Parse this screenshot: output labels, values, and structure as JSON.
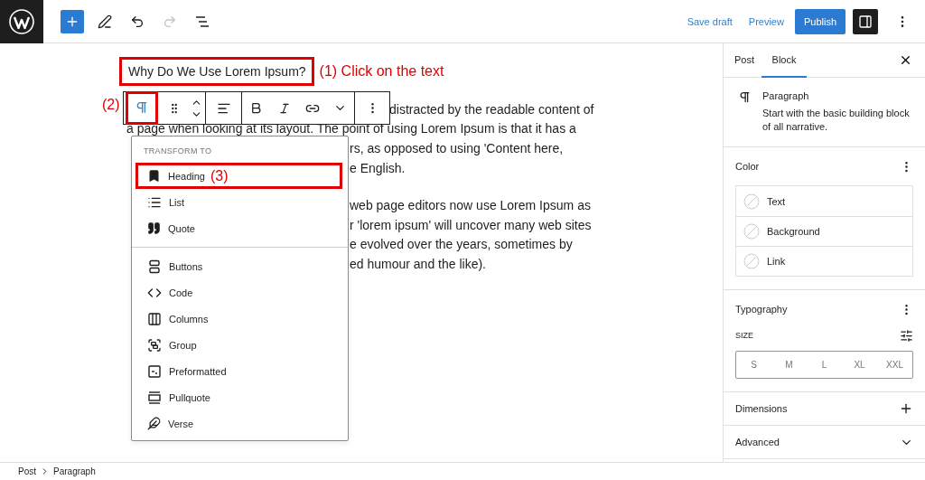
{
  "header": {
    "undo": {
      "disabled": false
    },
    "redo": {
      "disabled": true
    },
    "save_draft": "Save draft",
    "preview": "Preview",
    "publish": "Publish",
    "settings_pressed": true
  },
  "editor": {
    "heading": {
      "text": "Why Do We Use Lorem Ipsum?",
      "highlighted": true,
      "annotation": "(1) Click on the text"
    },
    "paragraphs": [
      {
        "lines": [
          {
            "kind": "after-toolbar",
            "text": "distracted by the readable content of"
          },
          {
            "kind": "full",
            "text": "a page when looking at its layout. The point of using Lorem Ipsum is that it has a"
          },
          {
            "kind": "after-menu",
            "text": "rs, as opposed to using 'Content here,"
          },
          {
            "kind": "after-menu",
            "text": "e English."
          }
        ]
      },
      {
        "lines": [
          {
            "kind": "after-menu",
            "text": "web page editors now use Lorem Ipsum as"
          },
          {
            "kind": "after-menu",
            "text": "r 'lorem ipsum' will uncover many web sites"
          },
          {
            "kind": "after-menu",
            "text": "e evolved over the years, sometimes by"
          },
          {
            "kind": "after-menu",
            "text": "ed humour and the like)."
          }
        ]
      }
    ],
    "toolbar": {
      "block_button_highlighted": true,
      "annotation": "(2)"
    },
    "transform_menu": {
      "title": "TRANSFORM TO",
      "sections": [
        {
          "items": [
            {
              "label": "Heading",
              "highlighted": true,
              "annotation": "(3)"
            },
            {
              "label": "List",
              "highlighted": false
            },
            {
              "label": "Quote",
              "highlighted": false
            }
          ]
        },
        {
          "items": [
            {
              "label": "Buttons",
              "highlighted": false
            },
            {
              "label": "Code",
              "highlighted": false
            },
            {
              "label": "Columns",
              "highlighted": false
            },
            {
              "label": "Group",
              "highlighted": false
            },
            {
              "label": "Preformatted",
              "highlighted": false
            },
            {
              "label": "Pullquote",
              "highlighted": false
            },
            {
              "label": "Verse",
              "highlighted": false
            }
          ]
        }
      ]
    }
  },
  "sidebar": {
    "tabs": [
      {
        "label": "Post",
        "selected": false
      },
      {
        "label": "Block",
        "selected": true
      }
    ],
    "block": {
      "title": "Paragraph",
      "description": "Start with the basic building block of all narrative."
    },
    "color": {
      "title": "Color",
      "items": [
        "Text",
        "Background",
        "Link"
      ]
    },
    "typography": {
      "title": "Typography",
      "size_label": "SIZE",
      "sizes": [
        "S",
        "M",
        "L",
        "XL",
        "XXL"
      ]
    },
    "panels": [
      {
        "title": "Dimensions",
        "kind": "add"
      },
      {
        "title": "Advanced",
        "kind": "collapsed"
      }
    ]
  },
  "breadcrumb": [
    "Post",
    "Paragraph"
  ]
}
